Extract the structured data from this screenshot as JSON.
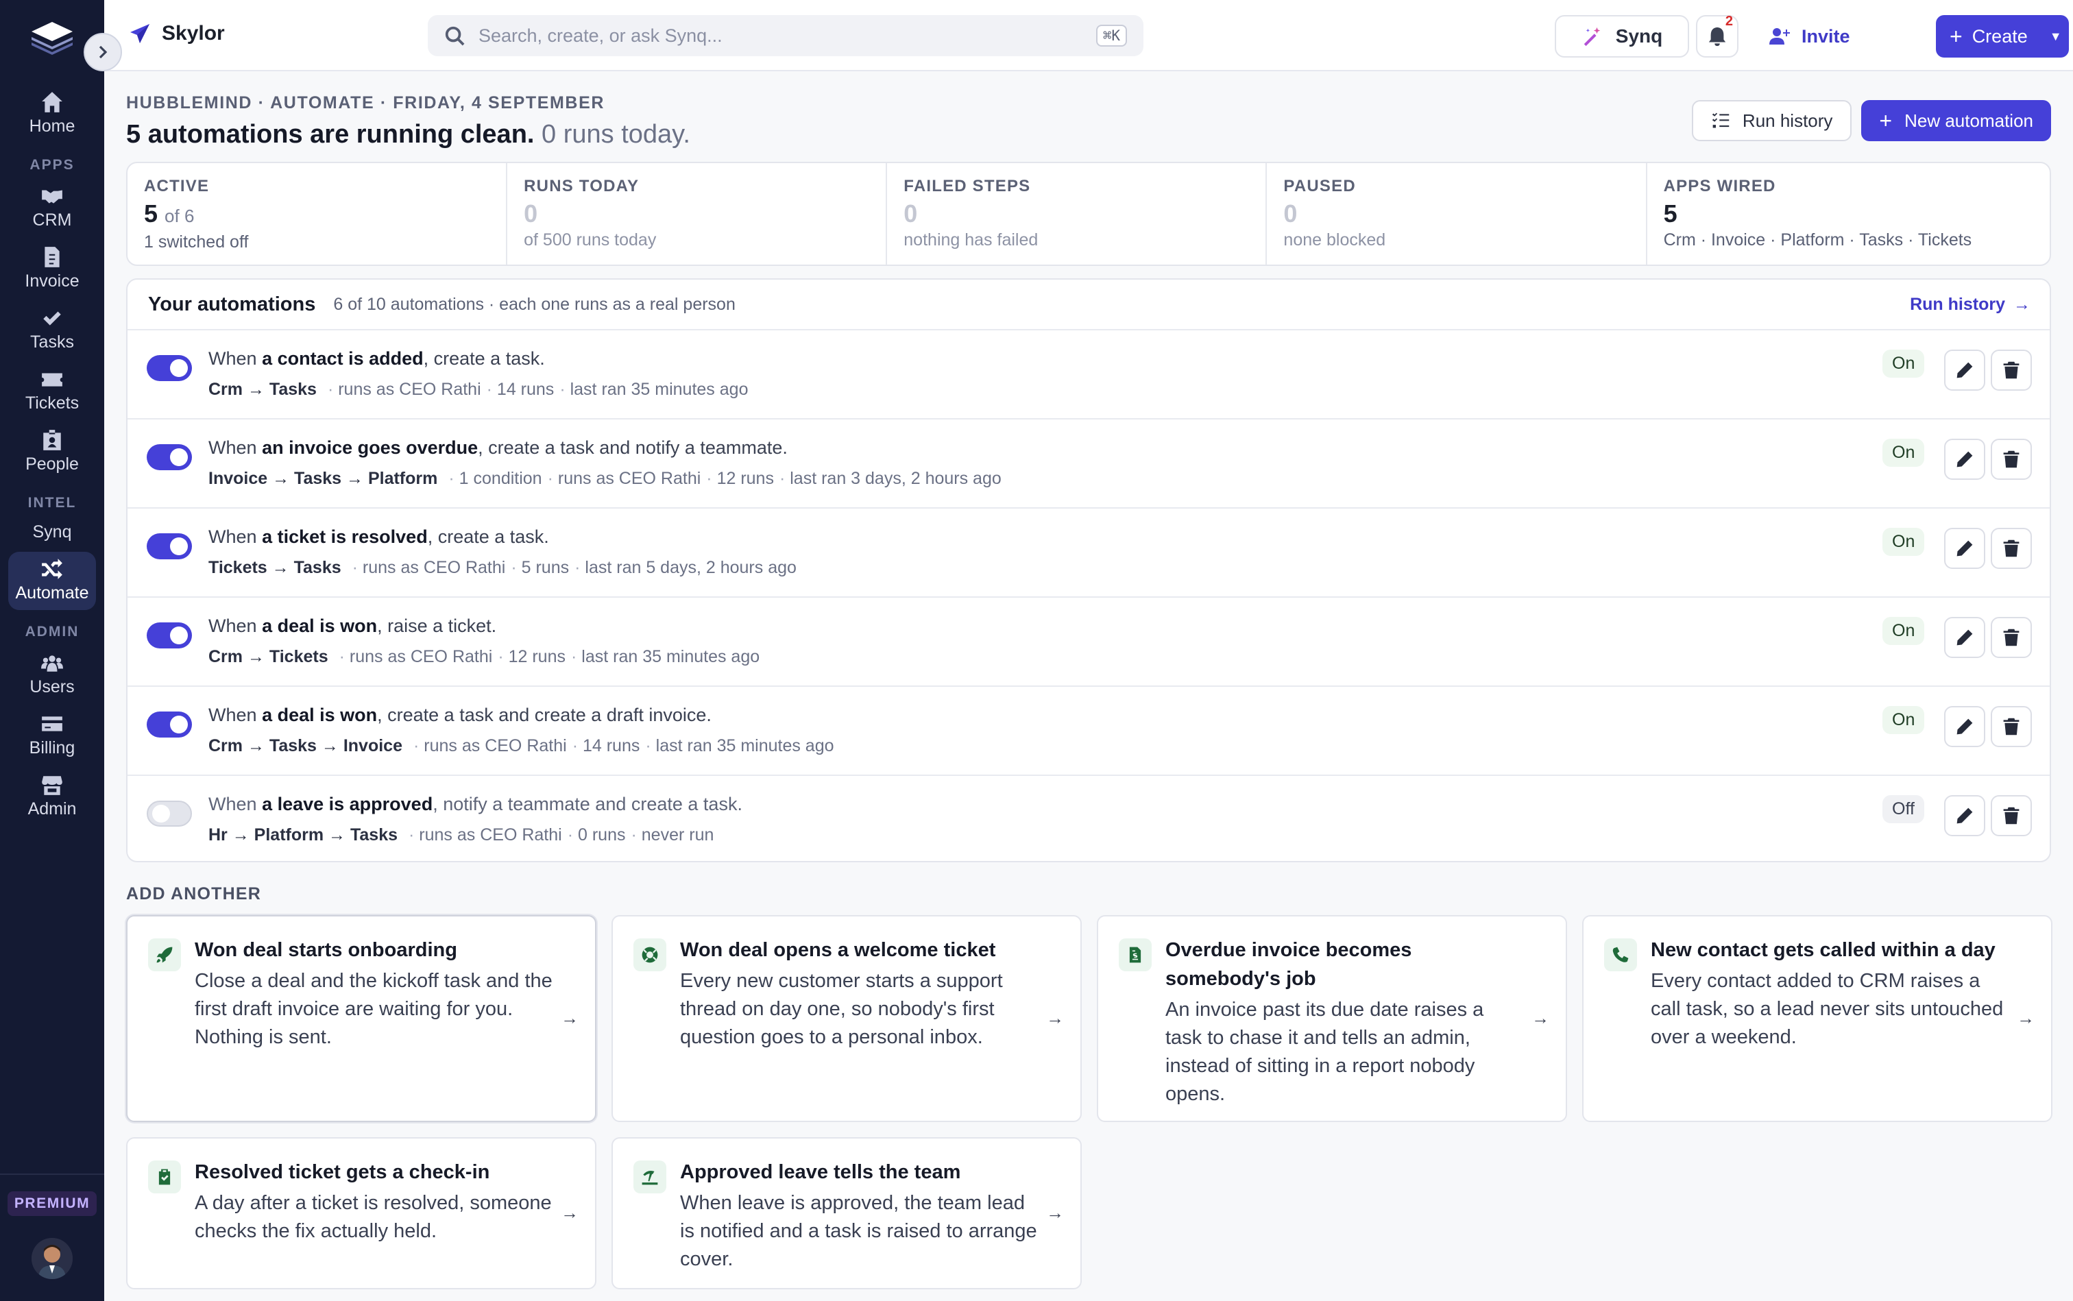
{
  "brand": {
    "name": "Skylor"
  },
  "search": {
    "placeholder": "Search, create, or ask Synq...",
    "shortcut": "⌘K"
  },
  "topbar": {
    "synq_label": "Synq",
    "notifications_count": "2",
    "invite_label": "Invite",
    "create_label": "Create"
  },
  "sidebar": {
    "items": [
      {
        "label": "Home",
        "icon": "home-icon"
      },
      {
        "section": "APPS"
      },
      {
        "label": "CRM",
        "icon": "handshake-icon"
      },
      {
        "label": "Invoice",
        "icon": "invoice-icon"
      },
      {
        "label": "Tasks",
        "icon": "check-icon"
      },
      {
        "label": "Tickets",
        "icon": "ticket-icon"
      },
      {
        "label": "People",
        "icon": "id-badge-icon"
      },
      {
        "section": "INTEL"
      },
      {
        "label": "Synq"
      },
      {
        "label": "Automate",
        "icon": "shuffle-icon",
        "active": true
      },
      {
        "section": "ADMIN"
      },
      {
        "label": "Users",
        "icon": "users-icon"
      },
      {
        "label": "Billing",
        "icon": "credit-card-icon"
      },
      {
        "label": "Admin",
        "icon": "store-icon"
      }
    ],
    "sections": {
      "apps": "APPS",
      "intel": "INTEL",
      "admin": "ADMIN"
    },
    "labels": {
      "home": "Home",
      "crm": "CRM",
      "invoice": "Invoice",
      "tasks": "Tasks",
      "tickets": "Tickets",
      "people": "People",
      "synq": "Synq",
      "automate": "Automate",
      "users": "Users",
      "billing": "Billing",
      "admin": "Admin"
    },
    "premium_badge": "PREMIUM"
  },
  "page": {
    "eyebrow": "HUBBLEMIND · AUTOMATE · FRIDAY, 4 SEPTEMBER",
    "headline": "5 automations are running clean.",
    "headline_muted": "0 runs today.",
    "run_history_label": "Run history",
    "new_automation_label": "New automation"
  },
  "stats": {
    "active": {
      "label": "ACTIVE",
      "value": "5",
      "of": "of 6",
      "sub": "1 switched off"
    },
    "runs": {
      "label": "RUNS TODAY",
      "value": "0",
      "sub": "of 500 runs today"
    },
    "failed": {
      "label": "FAILED STEPS",
      "value": "0",
      "sub": "nothing has failed"
    },
    "paused": {
      "label": "PAUSED",
      "value": "0",
      "sub": "none blocked"
    },
    "apps": {
      "label": "APPS WIRED",
      "value": "5",
      "sub": "Crm · Invoice · Platform · Tasks · Tickets"
    }
  },
  "automations": {
    "title": "Your automations",
    "subtitle": "6 of 10 automations · each one runs as a real person",
    "run_history_link": "Run history",
    "rows": [
      {
        "when": "When",
        "trigger": "a contact is added",
        "action": ", create a task.",
        "path": "Crm → Tasks",
        "meta": [
          "runs as CEO Rathi",
          "14 runs",
          "last ran 35 minutes ago"
        ],
        "status": "On",
        "enabled": true
      },
      {
        "when": "When",
        "trigger": "an invoice goes overdue",
        "action": ", create a task and notify a teammate.",
        "path": "Invoice → Tasks → Platform",
        "meta": [
          "1 condition",
          "runs as CEO Rathi",
          "12 runs",
          "last ran 3 days, 2 hours ago"
        ],
        "status": "On",
        "enabled": true
      },
      {
        "when": "When",
        "trigger": "a ticket is resolved",
        "action": ", create a task.",
        "path": "Tickets → Tasks",
        "meta": [
          "runs as CEO Rathi",
          "5 runs",
          "last ran 5 days, 2 hours ago"
        ],
        "status": "On",
        "enabled": true
      },
      {
        "when": "When",
        "trigger": "a deal is won",
        "action": ", raise a ticket.",
        "path": "Crm → Tickets",
        "meta": [
          "runs as CEO Rathi",
          "12 runs",
          "last ran 35 minutes ago"
        ],
        "status": "On",
        "enabled": true
      },
      {
        "when": "When",
        "trigger": "a deal is won",
        "action": ", create a task and create a draft invoice.",
        "path": "Crm → Tasks → Invoice",
        "meta": [
          "runs as CEO Rathi",
          "14 runs",
          "last ran 35 minutes ago"
        ],
        "status": "On",
        "enabled": true
      },
      {
        "when": "When",
        "trigger": "a leave is approved",
        "action": ", notify a teammate and create a task.",
        "path": "Hr → Platform → Tasks",
        "meta": [
          "runs as CEO Rathi",
          "0 runs",
          "never run"
        ],
        "status": "Off",
        "enabled": false
      }
    ]
  },
  "add_another": {
    "title": "ADD ANOTHER",
    "cards": [
      {
        "icon": "rocket-icon",
        "title": "Won deal starts onboarding",
        "desc": "Close a deal and the kickoff task and the first draft invoice are waiting for you. Nothing is sent."
      },
      {
        "icon": "lifebuoy-icon",
        "title": "Won deal opens a welcome ticket",
        "desc": "Every new customer starts a support thread on day one, so nobody's first question goes to a personal inbox."
      },
      {
        "icon": "file-invoice-icon",
        "title": "Overdue invoice becomes somebody's job",
        "desc": "An invoice past its due date raises a task to chase it and tells an admin, instead of sitting in a report nobody opens."
      },
      {
        "icon": "phone-icon",
        "title": "New contact gets called within a day",
        "desc": "Every contact added to CRM raises a call task, so a lead never sits untouched over a weekend."
      },
      {
        "icon": "clipboard-check-icon",
        "title": "Resolved ticket gets a check-in",
        "desc": "A day after a ticket is resolved, someone checks the fix actually held."
      },
      {
        "icon": "umbrella-beach-icon",
        "title": "Approved leave tells the team",
        "desc": "When leave is approved, the team lead is notified and a task is raised to arrange cover."
      }
    ]
  },
  "colors": {
    "accent": "#4540d8",
    "sidebar_bg": "#141a33",
    "on_pill": "#eef7ef"
  }
}
